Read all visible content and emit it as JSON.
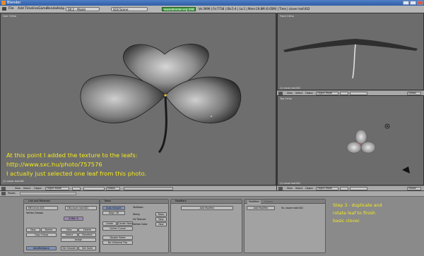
{
  "window": {
    "title": "Blender"
  },
  "menu": [
    "File",
    "Add",
    "Timeline",
    "Game",
    "Render",
    "Help"
  ],
  "header": {
    "screen": "SR:2 - Model",
    "scene": "SCE:Scene",
    "stats": "www.blender.org 248",
    "info": "Ve:3999 | Fa:7738 | Ob:5-4 | La:1  | Mem:19.8M (0.05M) | Time | clover leaf.002"
  },
  "viewports": {
    "main_label": "User Ortho",
    "right_label": "Front Ortho",
    "top_label": "Top Ortho",
    "obj_label": "(1) clover leaf.002",
    "menu_items": [
      "View",
      "Select",
      "Object"
    ],
    "mode": "Object Mode",
    "pivot": "Global"
  },
  "annotation": {
    "line1": "At this point I added the texture to the leafs:",
    "line2": "http://www.sxc.hu/photo/757576",
    "line3": "I actually just selected one leaf from this photo.",
    "step": [
      "Step 3 - duplicate and",
      "rotate leaf to finish",
      "basic clover."
    ]
  },
  "buttons_window": {
    "panels_label": "Panels",
    "tabs_link": "Link and Materials",
    "mesh_name": "ME:Circle.003",
    "ob_name": "OB:clover leaf.002",
    "vertex_groups": "Vertex Groups",
    "material_index": "0 Mat: 0",
    "btn_new": "New",
    "btn_delete": "Delete",
    "btn_copy_group": "Copy Group",
    "btn_select": "Select",
    "btn_deselect": "Deselect",
    "btn_assign": "Assign",
    "btn_set_smooth": "Set Smooth",
    "btn_set_solid": "Set Solid",
    "btn_autotex": "AutoTexSpace",
    "tab_mesh": "Mesh",
    "auto_smooth": "Auto Smooth",
    "degr": "Degr: 30",
    "center": "Center",
    "center_new": "Center New",
    "center_cursor": "Center Cursor",
    "double_sided": "Double Sided",
    "no_vnormal_flip": "No V.Normal Flip",
    "texmesh": "TexMesh:",
    "sticky": "Sticky",
    "uv_texture": "UV Texture",
    "vertex_color": "Vertex Color",
    "make": "Make",
    "new_btn": "New",
    "new_btn2": "New",
    "tab_modifiers": "Modifiers",
    "add_modifier": "Add Modifier",
    "tab_modifiers2": "Modifiers",
    "tab_shapes": "Shapes",
    "add_modifier2": "Add Modifier",
    "to_label": "To: clover leaf.002"
  }
}
